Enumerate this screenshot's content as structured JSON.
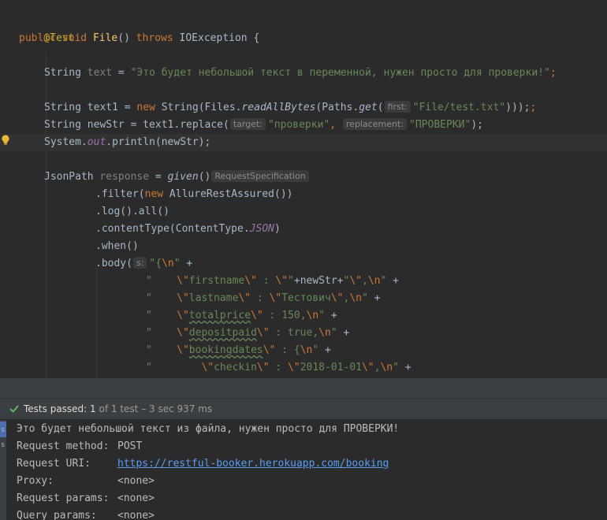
{
  "editor": {
    "annotation": "@Test",
    "method_sig": {
      "mod": "public",
      "type": "void",
      "name": "File",
      "parens": "()",
      "throws": "throws",
      "exc": "IOException",
      "brace": " {"
    },
    "text_decl": {
      "type": "String",
      "var": "text",
      "eq": " = ",
      "str": "\"Это будет небольшой текст в переменной, нужен просто для проверки!\"",
      "semi": ";"
    },
    "text1_decl": {
      "type": "String",
      "rest1": " text1 = ",
      "kw_new": "new",
      "rest2": " String(Files.",
      "m1": "readAllBytes",
      "rest3": "(Paths.",
      "m2": "get",
      "paren": "(",
      "hint": "first:",
      "str": "\"File/test.txt\"",
      "close": ")));",
      "semi2": ";"
    },
    "newstr_decl": {
      "type": "String",
      "rest1": " newStr = text1.replace(",
      "hint1": "target:",
      "str1": "\"проверки\"",
      "comma": ",",
      "hint2": "replacement:",
      "str2": "\"ПРОВЕРКИ\"",
      "close": ");"
    },
    "println_line": {
      "a": "System.",
      "out": "out",
      "b": ".println(newStr);"
    },
    "jsonpath_decl": {
      "type": "JsonPath",
      "var": "response",
      "eq": " = ",
      "m": "given",
      "paren": "()",
      "hint": "RequestSpecification"
    },
    "filter_line": {
      "a": ".filter(",
      "kw_new": "new",
      "b": " AllureRestAssured())"
    },
    "log_line": ".log().all()",
    "content_line": {
      "a": ".contentType(ContentType.",
      "c": "JSON",
      "b": ")"
    },
    "when_line": ".when()",
    "body_line": {
      "a": ".body(",
      "hint": "s:",
      "str": "\"{",
      "esc": "\\n",
      "q": "\"",
      "plus": " +"
    },
    "firstname_line": {
      "q1": "\"    ",
      "e1": "\\\"",
      "w": "firstname",
      "e2": "\\\"",
      "t1": " : ",
      "e3": "\\\"",
      "q2": "\"",
      "mid": "+newStr+",
      "q3": "\"",
      "e4": "\\\"",
      "comma": ",",
      "e5": "\\n",
      "q4": "\"",
      "plus": " +"
    },
    "lastname_line": {
      "q1": "\"    ",
      "e1": "\\\"",
      "w": "lastname",
      "e2": "\\\"",
      "t1": " : ",
      "e3": "\\\"",
      "val": "Тестович",
      "e4": "\\\"",
      "comma": ",",
      "e5": "\\n",
      "q2": "\"",
      "plus": " +"
    },
    "totalprice_line": {
      "q1": "\"    ",
      "e1": "\\\"",
      "w": "totalprice",
      "e2": "\\\"",
      "t1": " : 150,",
      "e3": "\\n",
      "q2": "\"",
      "plus": " +"
    },
    "depositpaid_line": {
      "q1": "\"    ",
      "e1": "\\\"",
      "w": "depositpaid",
      "e2": "\\\"",
      "t1": " : true,",
      "e3": "\\n",
      "q2": "\"",
      "plus": " +"
    },
    "bookingdates_line": {
      "q1": "\"    ",
      "e1": "\\\"",
      "w": "bookingdates",
      "e2": "\\\"",
      "t1": " : {",
      "e3": "\\n",
      "q2": "\"",
      "plus": " +"
    },
    "checkin_line": {
      "q1": "\"        ",
      "e1": "\\\"",
      "w": "checkin",
      "e2": "\\\"",
      "t1": " : ",
      "e3": "\\\"",
      "val": "2018-01-01",
      "e4": "\\\"",
      "comma": ",",
      "e5": "\\n",
      "q2": "\"",
      "plus": " +"
    }
  },
  "status": {
    "passed_label": "Tests passed:",
    "passed_count": "1",
    "rest": "of 1 test – 3 sec 937 ms"
  },
  "console": {
    "lines": [
      {
        "label": "Это будет небольшой текст из файла, нужен просто для ПРОВЕРКИ!"
      },
      {
        "label": "Request method:",
        "value": "POST"
      },
      {
        "label": "Request URI:",
        "value": "https://restful-booker.herokuapp.com/booking"
      },
      {
        "label": "Proxy:",
        "value": "<none>"
      },
      {
        "label": "Request params:",
        "value": "<none>"
      },
      {
        "label": "Query params:",
        "value": "<none>"
      }
    ],
    "strip_marks": [
      "s",
      "s"
    ]
  },
  "colors": {
    "keyword": "#cc7832",
    "method_decl": "#ffc66d",
    "string": "#6a8759",
    "annotation": "#bbb529",
    "static_field": "#9876aa",
    "link": "#589df6",
    "success": "#5fb85f"
  },
  "icons": [
    "lightbulb-icon",
    "checkmark-icon"
  ]
}
